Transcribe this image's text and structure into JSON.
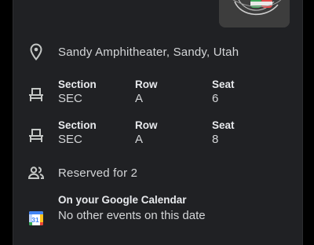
{
  "location": {
    "text": "Sandy Amphitheater, Sandy, Utah"
  },
  "tickets": [
    {
      "section_label": "Section",
      "section_value": "SEC",
      "row_label": "Row",
      "row_value": "A",
      "seat_label": "Seat",
      "seat_value": "6"
    },
    {
      "section_label": "Section",
      "section_value": "SEC",
      "row_label": "Row",
      "row_value": "A",
      "seat_label": "Seat",
      "seat_value": "8"
    }
  ],
  "reservation": {
    "text": "Reserved for 2"
  },
  "calendar": {
    "title": "On your Google Calendar",
    "subtitle": "No other events on this date",
    "icon_day": "31"
  },
  "colors": {
    "card_bg": "#202124",
    "page_bg": "#000000",
    "primary_text": "#e8eaed",
    "secondary_text": "#d4d6d8",
    "icon": "#c4c7c5",
    "calendar_blue": "#4285f4"
  },
  "icons": {
    "location": "location-pin-icon",
    "seat": "seat-icon",
    "people": "people-icon",
    "calendar": "google-calendar-icon"
  }
}
